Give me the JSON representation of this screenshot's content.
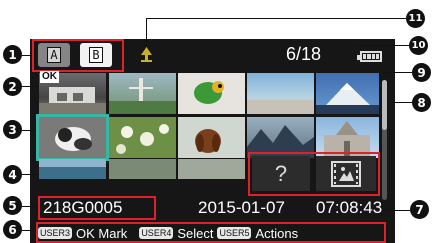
{
  "slots": {
    "a": "A",
    "b": "B"
  },
  "status": {
    "counter": "6/18",
    "ok_mark": "OK"
  },
  "clip": {
    "name": "218G0005",
    "date": "2015-01-07",
    "time": "07:08:43"
  },
  "guide": {
    "key1": "USER3",
    "label1": "OK Mark",
    "key2": "USER4",
    "label2": "Select",
    "key3": "USER5",
    "label3": "Actions"
  },
  "thumbnails": {
    "unknown_symbol": "?"
  },
  "callouts": [
    "1",
    "2",
    "3",
    "4",
    "5",
    "6",
    "7",
    "8",
    "9",
    "10",
    "11"
  ]
}
